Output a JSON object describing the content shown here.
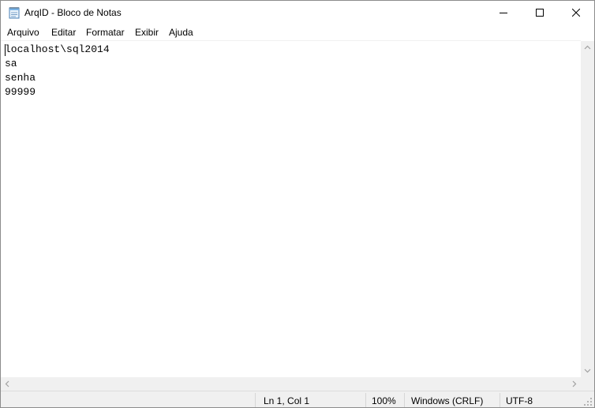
{
  "window": {
    "title": "ArqID - Bloco de Notas"
  },
  "menu": {
    "items": [
      "Arquivo",
      "Editar",
      "Formatar",
      "Exibir",
      "Ajuda"
    ]
  },
  "editor": {
    "lines": [
      "localhost\\sql2014",
      "sa",
      "senha",
      "99999"
    ]
  },
  "statusbar": {
    "position": "Ln 1, Col 1",
    "zoom": "100%",
    "line_ending": "Windows (CRLF)",
    "encoding": "UTF-8"
  },
  "icons": {
    "app": "notepad-icon",
    "minimize": "minimize-icon",
    "maximize": "maximize-icon",
    "close": "close-icon"
  }
}
